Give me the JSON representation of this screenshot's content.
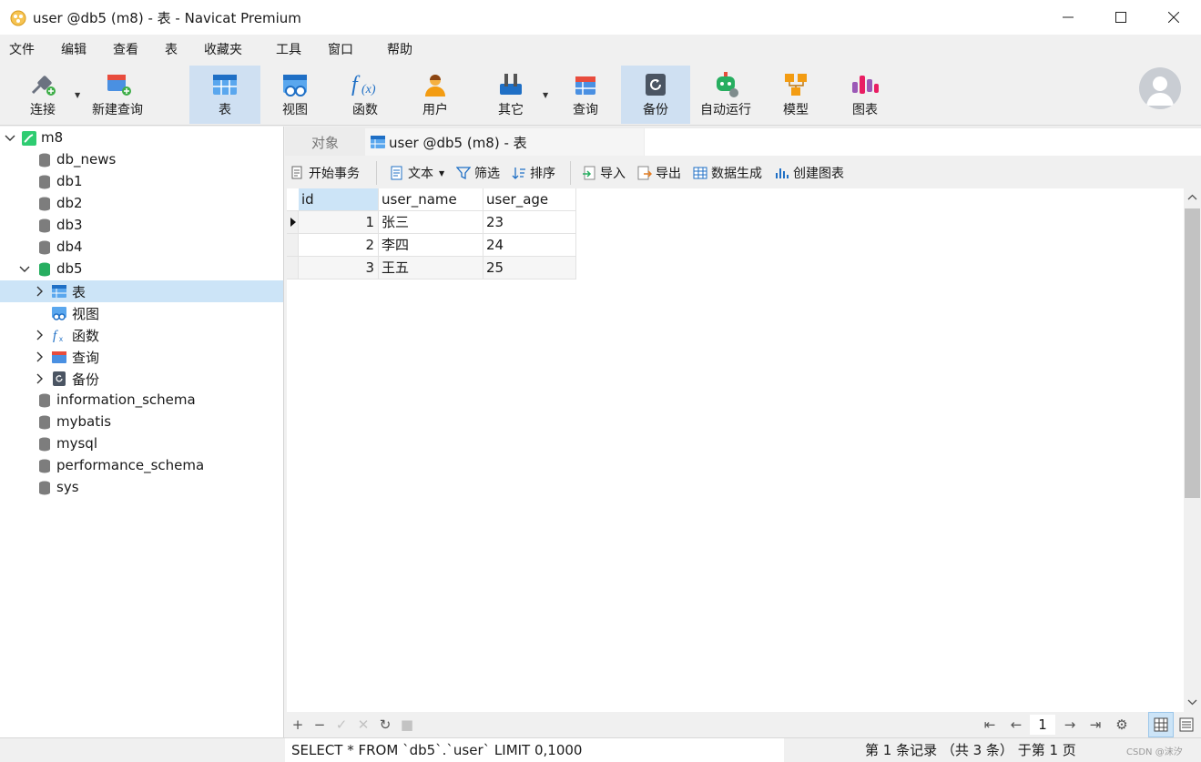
{
  "window": {
    "title": "user @db5 (m8) - 表 - Navicat Premium"
  },
  "menu": [
    "文件",
    "编辑",
    "查看",
    "表",
    "收藏夹",
    "工具",
    "窗口",
    "帮助"
  ],
  "toolbar": {
    "connect": "连接",
    "new_query": "新建查询",
    "table": "表",
    "view": "视图",
    "function": "函数",
    "user": "用户",
    "other": "其它",
    "query": "查询",
    "backup": "备份",
    "automation": "自动运行",
    "model": "模型",
    "chart": "图表"
  },
  "sidebar": {
    "connection": "m8",
    "databases": [
      "db_news",
      "db1",
      "db2",
      "db3",
      "db4",
      "db5"
    ],
    "db5_children": [
      "表",
      "视图",
      "函数",
      "查询",
      "备份"
    ],
    "other_databases": [
      "information_schema",
      "mybatis",
      "mysql",
      "performance_schema",
      "sys"
    ]
  },
  "tabs": {
    "objects": "对象",
    "active": "user @db5 (m8) - 表"
  },
  "subtoolbar": {
    "begin_transaction": "开始事务",
    "text": "文本",
    "filter": "筛选",
    "sort": "排序",
    "import": "导入",
    "export": "导出",
    "data_generation": "数据生成",
    "create_chart": "创建图表"
  },
  "grid": {
    "columns": [
      "id",
      "user_name",
      "user_age"
    ],
    "rows": [
      [
        "1",
        "张三",
        "23"
      ],
      [
        "2",
        "李四",
        "24"
      ],
      [
        "3",
        "王五",
        "25"
      ]
    ]
  },
  "pager": {
    "page": "1"
  },
  "status": {
    "sql": "SELECT * FROM `db5`.`user` LIMIT 0,1000",
    "record_info": "第 1 条记录 （共 3 条） 于第 1 页",
    "watermark": "CSDN @沫汐"
  }
}
